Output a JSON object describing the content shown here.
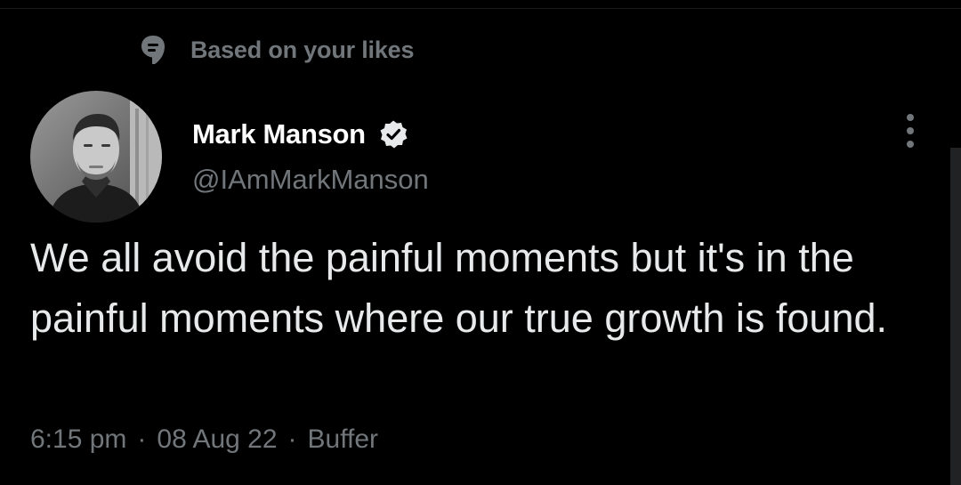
{
  "social_context": {
    "icon": "speech-bubble-icon",
    "label": "Based on your likes"
  },
  "author": {
    "name": "Mark Manson",
    "handle": "@IAmMarkManson",
    "verified_icon": "verified-badge-icon"
  },
  "tweet": {
    "text": "We all avoid the painful moments but it's in the painful moments where our true growth is found."
  },
  "meta": {
    "time": "6:15 pm",
    "date": "08 Aug 22",
    "separator": "·",
    "source": "Buffer"
  },
  "more_icon": "more-vertical-icon",
  "colors": {
    "background": "#000000",
    "primary_text": "#e7e9ea",
    "secondary_text": "#71767b"
  }
}
